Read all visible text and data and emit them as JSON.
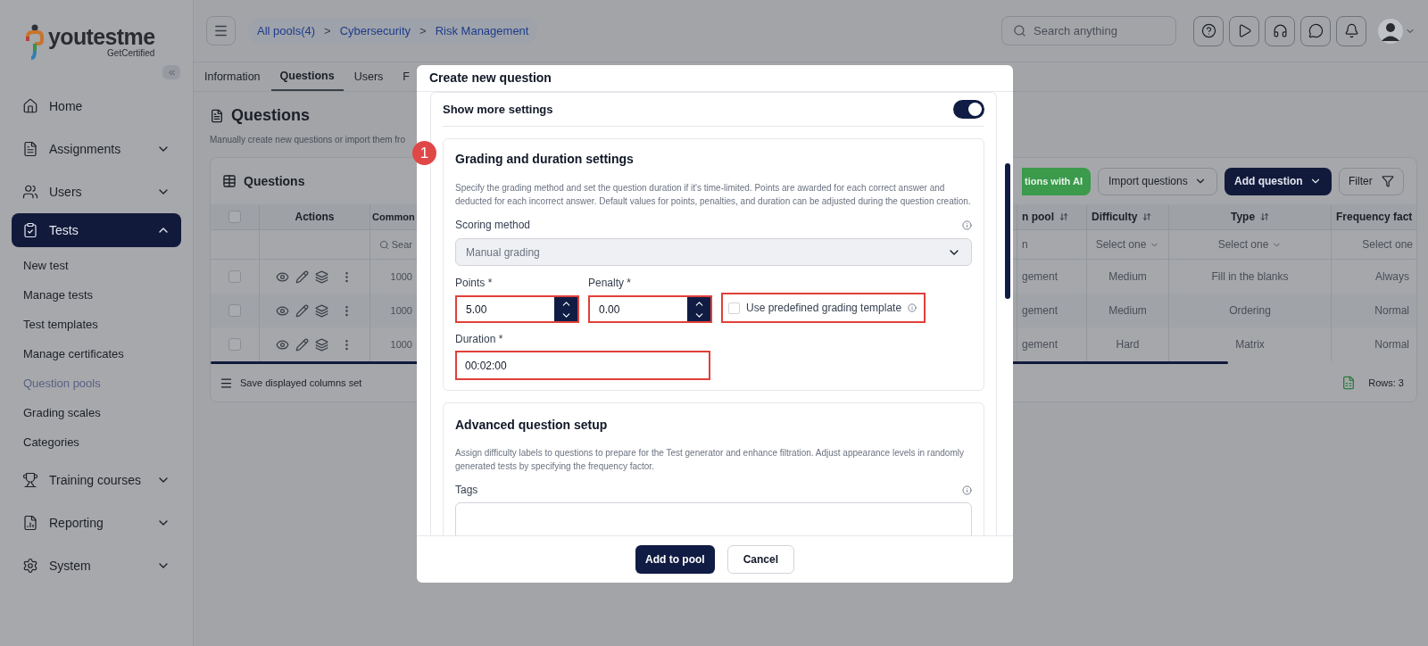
{
  "sidebar": {
    "logo": {
      "wordmark": "youtestme",
      "tagline": "GetCertified"
    },
    "items": [
      {
        "kind": "link",
        "label": "Home",
        "selected": false
      },
      {
        "kind": "group",
        "label": "Assignments",
        "selected": false,
        "expanded": false
      },
      {
        "kind": "group",
        "label": "Users",
        "selected": false,
        "expanded": false
      },
      {
        "kind": "group",
        "label": "Tests",
        "selected": true,
        "expanded": true,
        "children": [
          {
            "label": "New test",
            "selected": false
          },
          {
            "label": "Manage tests",
            "selected": false
          },
          {
            "label": "Test templates",
            "selected": false
          },
          {
            "label": "Manage certificates",
            "selected": false
          },
          {
            "label": "Question pools",
            "selected": true
          },
          {
            "label": "Grading scales",
            "selected": false
          },
          {
            "label": "Categories",
            "selected": false
          }
        ]
      },
      {
        "kind": "group",
        "label": "Training courses",
        "selected": false,
        "expanded": false
      },
      {
        "kind": "group",
        "label": "Reporting",
        "selected": false,
        "expanded": false
      },
      {
        "kind": "group",
        "label": "System",
        "selected": false,
        "expanded": false
      }
    ]
  },
  "top_bar": {
    "breadcrumbs": [
      {
        "label": "All pools(4)"
      },
      {
        "separator": ">",
        "label": "Cybersecurity"
      },
      {
        "separator": ">",
        "label": "Risk Management"
      }
    ],
    "search": {
      "placeholder": "Search anything"
    }
  },
  "tabs": [
    {
      "label": "Information",
      "selected": false
    },
    {
      "label": "Questions",
      "selected": true
    },
    {
      "label": "Users",
      "selected": false
    },
    {
      "label": "F",
      "selected": false
    }
  ],
  "page": {
    "title": "Questions",
    "description": "Manually create new questions or import them fro"
  },
  "card": {
    "title": "Questions",
    "toolbar": [
      {
        "kind": "ai",
        "label": "tions with AI"
      },
      {
        "kind": "dropdown",
        "label": "Import questions"
      },
      {
        "kind": "primary",
        "label": "Add question"
      },
      {
        "kind": "filter",
        "label": "Filter"
      }
    ],
    "table": {
      "all_checked": false,
      "left_columns": [
        "Actions",
        "Common"
      ],
      "left_filter_placeholder": "Sear",
      "right_columns": [
        {
          "label": "n pool",
          "sortable": true
        },
        {
          "label": "Difficulty",
          "sortable": true
        },
        {
          "label": "Type",
          "sortable": true
        },
        {
          "label": "Frequency fact"
        }
      ],
      "right_filters": [
        {
          "kind": "text",
          "value": "n"
        },
        {
          "kind": "select",
          "placeholder": "Select one"
        },
        {
          "kind": "select",
          "placeholder": "Select one"
        },
        {
          "kind": "text",
          "placeholder": "Select one"
        }
      ],
      "rows": [
        {
          "checked": false,
          "common": "1000",
          "cells": [
            "gement",
            "Medium",
            "Fill in the blanks",
            "Always"
          ]
        },
        {
          "checked": false,
          "common": "1000",
          "cells": [
            "gement",
            "Medium",
            "Ordering",
            "Normal"
          ]
        },
        {
          "checked": false,
          "common": "1000",
          "cells": [
            "gement",
            "Hard",
            "Matrix",
            "Normal"
          ]
        }
      ]
    },
    "footer": {
      "save_label": "Save displayed columns set",
      "rows_label": "Rows: 3"
    }
  },
  "modal": {
    "title": "Create new question",
    "show_more": {
      "label": "Show more settings",
      "on": true
    },
    "grading": {
      "title": "Grading and duration settings",
      "description": "Specify the grading method and set the question duration if it's time-limited. Points are awarded for each correct answer and deducted for each incorrect answer. Default values for points, penalties, and duration can be adjusted during the question creation.",
      "scoring": {
        "label": "Scoring method",
        "value": "Manual grading",
        "disabled": true
      },
      "points": {
        "label": "Points *",
        "value": "5.00",
        "highlighted": true
      },
      "penalty": {
        "label": "Penalty *",
        "value": "0.00",
        "highlighted": true
      },
      "template": {
        "label": "Use predefined grading template",
        "checked": false,
        "highlighted": true
      },
      "duration": {
        "label": "Duration *",
        "value": "00:02:00",
        "highlighted": true
      }
    },
    "advanced": {
      "title": "Advanced question setup",
      "description": "Assign difficulty labels to questions to prepare for the Test generator and enhance filtration. Adjust appearance levels in randomly generated tests by specifying the frequency factor.",
      "tags": {
        "label": "Tags"
      }
    },
    "buttons": [
      {
        "kind": "primary",
        "label": "Add to pool"
      },
      {
        "kind": "secondary",
        "label": "Cancel"
      }
    ]
  },
  "step_badge": "1"
}
